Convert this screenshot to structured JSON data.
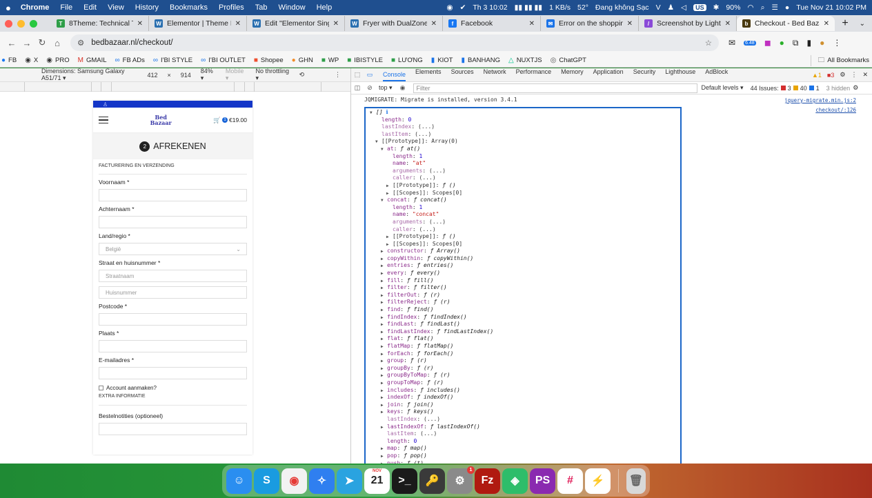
{
  "menubar": {
    "app": "Chrome",
    "menus": [
      "File",
      "Edit",
      "View",
      "History",
      "Bookmarks",
      "Profiles",
      "Tab",
      "Window",
      "Help"
    ],
    "clock_vn": "Th 3 10:02",
    "net_speed": "1 KB/s",
    "temp": "52°",
    "charge_status": "Đang không Sạc",
    "input_source": "US",
    "battery": "90%",
    "datetime": "Tue Nov 21  10:02 PM"
  },
  "tabs": [
    {
      "title": "8Theme: Technical Ticke",
      "icon": "8theme-icon",
      "color": "#2e9e48",
      "glyph": "T"
    },
    {
      "title": "Elementor | Theme Builde",
      "icon": "wordpress-icon",
      "color": "#2a6fb0",
      "glyph": "W"
    },
    {
      "title": "Edit \"Elementor Single Pr",
      "icon": "wordpress-icon",
      "color": "#2a6fb0",
      "glyph": "W"
    },
    {
      "title": "Fryer with DualZone – xs",
      "icon": "wordpress-icon",
      "color": "#2a6fb0",
      "glyph": "W"
    },
    {
      "title": "Facebook",
      "icon": "facebook-icon",
      "color": "#1877f2",
      "glyph": "f"
    },
    {
      "title": "Error on the shopping ca",
      "icon": "outlook-icon",
      "color": "#1a73e8",
      "glyph": "✉"
    },
    {
      "title": "Screenshot by Lightshot",
      "icon": "lightshot-icon",
      "color": "#8a4ad8",
      "glyph": "/"
    },
    {
      "title": "Checkout - Bed Bazaar",
      "icon": "bedbazaar-icon",
      "color": "#4a3a10",
      "glyph": "b",
      "active": true
    }
  ],
  "address": {
    "url": "bedbazaar.nl/checkout/",
    "ext_badge": "6.48"
  },
  "bookmarks": [
    {
      "label": "FB",
      "glyph": "●",
      "color": "#1877f2"
    },
    {
      "label": "X",
      "glyph": "◉",
      "color": "#333"
    },
    {
      "label": "PRO",
      "glyph": "◉",
      "color": "#333"
    },
    {
      "label": "GMAIL",
      "glyph": "M",
      "color": "#d93025"
    },
    {
      "label": "FB ADs",
      "glyph": "∞",
      "color": "#1a73e8"
    },
    {
      "label": "I'BI STYLE",
      "glyph": "∞",
      "color": "#1a73e8"
    },
    {
      "label": "I'BI OUTLET",
      "glyph": "∞",
      "color": "#1a73e8"
    },
    {
      "label": "Shopee",
      "glyph": "■",
      "color": "#ee4d2d"
    },
    {
      "label": "GHN",
      "glyph": "●",
      "color": "#f28c28"
    },
    {
      "label": "WP",
      "glyph": "■",
      "color": "#2e9e48"
    },
    {
      "label": "IBISTYLE",
      "glyph": "■",
      "color": "#2e9e48"
    },
    {
      "label": "LƯƠNG",
      "glyph": "■",
      "color": "#2e9e48"
    },
    {
      "label": "KIOT",
      "glyph": "▮",
      "color": "#1a73e8"
    },
    {
      "label": "BANHANG",
      "glyph": "▮",
      "color": "#1a73e8"
    },
    {
      "label": "NUXTJS",
      "glyph": "△",
      "color": "#00c58e"
    },
    {
      "label": "ChatGPT",
      "glyph": "◎",
      "color": "#555"
    }
  ],
  "all_bookmarks": "All Bookmarks",
  "device_toolbar": {
    "dimensions": "Dimensions: Samsung Galaxy A51/71 ▾",
    "width": "412",
    "x": "×",
    "height": "914",
    "zoom": "84% ▾",
    "mode": "Mobile ▾",
    "throttling": "No throttling ▾"
  },
  "site": {
    "cart_count": "1",
    "cart_total": "€19.00",
    "logo_line1": "Bed",
    "logo_line2": "Bazaar",
    "step": "2",
    "title": "AFREKENEN",
    "section_billing": "FACTURERING EN VERZENDING",
    "fields": {
      "first_name": "Voornaam *",
      "last_name": "Achternaam *",
      "country": "Land/regio *",
      "country_value": "België",
      "street": "Straat en huisnummer *",
      "street_placeholder": "Straatnaam",
      "house_placeholder": "Huisnummer",
      "postcode": "Postcode *",
      "city": "Plaats *",
      "email": "E-mailadres *"
    },
    "create_account": "Account aanmaken?",
    "section_extra": "EXTRA INFORMATIE",
    "order_notes": "Bestelnotities (optioneel)"
  },
  "devtools": {
    "tabs": [
      "Console",
      "Elements",
      "Sources",
      "Network",
      "Performance",
      "Memory",
      "Application",
      "Security",
      "Lighthouse",
      "AdBlock"
    ],
    "active_tab": "Console",
    "warnings": "1",
    "errors": "3",
    "context": "top ▾",
    "filter_placeholder": "Filter",
    "levels": "Default levels ▾",
    "issues_label": "44 Issues:",
    "issues_err": "3",
    "issues_warn": "40",
    "issues_info": "1",
    "hidden": "3 hidden",
    "console": {
      "migrate_msg": "JQMIGRATE: Migrate is installed, version 3.4.1",
      "migrate_src": "jquery-migrate.min.js:2",
      "log_src": "checkout/:126",
      "lines": [
        {
          "ind": 0,
          "arrow": "▼",
          "key": "[]",
          "val": "",
          "kc": "fn"
        },
        {
          "ind": 1,
          "arrow": "",
          "key": "length",
          "val": "0",
          "vc": "v"
        },
        {
          "ind": 1,
          "arrow": "",
          "key": "lastIndex",
          "val": "(...)",
          "kdim": true
        },
        {
          "ind": 1,
          "arrow": "",
          "key": "lastItem",
          "val": "(...)",
          "kdim": true
        },
        {
          "ind": 1,
          "arrow": "▼",
          "key": "[[Prototype]]",
          "val": "Array(0)",
          "kplain": true
        },
        {
          "ind": 2,
          "arrow": "▼",
          "key": "at",
          "val": "ƒ at()",
          "vc": "fn"
        },
        {
          "ind": 3,
          "arrow": "",
          "key": "length",
          "val": "1",
          "vc": "v"
        },
        {
          "ind": 3,
          "arrow": "",
          "key": "name",
          "val": "\"at\"",
          "vc": "s"
        },
        {
          "ind": 3,
          "arrow": "",
          "key": "arguments",
          "val": "(...)",
          "kdim": true
        },
        {
          "ind": 3,
          "arrow": "",
          "key": "caller",
          "val": "(...)",
          "kdim": true
        },
        {
          "ind": 3,
          "arrow": "▶",
          "key": "[[Prototype]]",
          "val": "ƒ ()",
          "vc": "fn",
          "kplain": true
        },
        {
          "ind": 3,
          "arrow": "▶",
          "key": "[[Scopes]]",
          "val": "Scopes[0]",
          "kplain": true
        },
        {
          "ind": 2,
          "arrow": "▼",
          "key": "concat",
          "val": "ƒ concat()",
          "vc": "fn"
        },
        {
          "ind": 3,
          "arrow": "",
          "key": "length",
          "val": "1",
          "vc": "v"
        },
        {
          "ind": 3,
          "arrow": "",
          "key": "name",
          "val": "\"concat\"",
          "vc": "s"
        },
        {
          "ind": 3,
          "arrow": "",
          "key": "arguments",
          "val": "(...)",
          "kdim": true
        },
        {
          "ind": 3,
          "arrow": "",
          "key": "caller",
          "val": "(...)",
          "kdim": true
        },
        {
          "ind": 3,
          "arrow": "▶",
          "key": "[[Prototype]]",
          "val": "ƒ ()",
          "vc": "fn",
          "kplain": true
        },
        {
          "ind": 3,
          "arrow": "▶",
          "key": "[[Scopes]]",
          "val": "Scopes[0]",
          "kplain": true
        },
        {
          "ind": 2,
          "arrow": "▶",
          "key": "constructor",
          "val": "ƒ Array()",
          "vc": "fn"
        },
        {
          "ind": 2,
          "arrow": "▶",
          "key": "copyWithin",
          "val": "ƒ copyWithin()",
          "vc": "fn"
        },
        {
          "ind": 2,
          "arrow": "▶",
          "key": "entries",
          "val": "ƒ entries()",
          "vc": "fn"
        },
        {
          "ind": 2,
          "arrow": "▶",
          "key": "every",
          "val": "ƒ every()",
          "vc": "fn"
        },
        {
          "ind": 2,
          "arrow": "▶",
          "key": "fill",
          "val": "ƒ fill()",
          "vc": "fn"
        },
        {
          "ind": 2,
          "arrow": "▶",
          "key": "filter",
          "val": "ƒ filter()",
          "vc": "fn"
        },
        {
          "ind": 2,
          "arrow": "▶",
          "key": "filterOut",
          "val": "ƒ (r)",
          "vc": "fn"
        },
        {
          "ind": 2,
          "arrow": "▶",
          "key": "filterReject",
          "val": "ƒ (r)",
          "vc": "fn"
        },
        {
          "ind": 2,
          "arrow": "▶",
          "key": "find",
          "val": "ƒ find()",
          "vc": "fn"
        },
        {
          "ind": 2,
          "arrow": "▶",
          "key": "findIndex",
          "val": "ƒ findIndex()",
          "vc": "fn"
        },
        {
          "ind": 2,
          "arrow": "▶",
          "key": "findLast",
          "val": "ƒ findLast()",
          "vc": "fn"
        },
        {
          "ind": 2,
          "arrow": "▶",
          "key": "findLastIndex",
          "val": "ƒ findLastIndex()",
          "vc": "fn"
        },
        {
          "ind": 2,
          "arrow": "▶",
          "key": "flat",
          "val": "ƒ flat()",
          "vc": "fn"
        },
        {
          "ind": 2,
          "arrow": "▶",
          "key": "flatMap",
          "val": "ƒ flatMap()",
          "vc": "fn"
        },
        {
          "ind": 2,
          "arrow": "▶",
          "key": "forEach",
          "val": "ƒ forEach()",
          "vc": "fn"
        },
        {
          "ind": 2,
          "arrow": "▶",
          "key": "group",
          "val": "ƒ (r)",
          "vc": "fn"
        },
        {
          "ind": 2,
          "arrow": "▶",
          "key": "groupBy",
          "val": "ƒ (r)",
          "vc": "fn"
        },
        {
          "ind": 2,
          "arrow": "▶",
          "key": "groupByToMap",
          "val": "ƒ (r)",
          "vc": "fn"
        },
        {
          "ind": 2,
          "arrow": "▶",
          "key": "groupToMap",
          "val": "ƒ (r)",
          "vc": "fn"
        },
        {
          "ind": 2,
          "arrow": "▶",
          "key": "includes",
          "val": "ƒ includes()",
          "vc": "fn"
        },
        {
          "ind": 2,
          "arrow": "▶",
          "key": "indexOf",
          "val": "ƒ indexOf()",
          "vc": "fn"
        },
        {
          "ind": 2,
          "arrow": "▶",
          "key": "join",
          "val": "ƒ join()",
          "vc": "fn"
        },
        {
          "ind": 2,
          "arrow": "▶",
          "key": "keys",
          "val": "ƒ keys()",
          "vc": "fn"
        },
        {
          "ind": 2,
          "arrow": "",
          "key": "lastIndex",
          "val": "(...)",
          "kdim": true
        },
        {
          "ind": 2,
          "arrow": "▶",
          "key": "lastIndexOf",
          "val": "ƒ lastIndexOf()",
          "vc": "fn"
        },
        {
          "ind": 2,
          "arrow": "",
          "key": "lastItem",
          "val": "(...)",
          "kdim": true
        },
        {
          "ind": 2,
          "arrow": "",
          "key": "length",
          "val": "0",
          "vc": "v"
        },
        {
          "ind": 2,
          "arrow": "▶",
          "key": "map",
          "val": "ƒ map()",
          "vc": "fn"
        },
        {
          "ind": 2,
          "arrow": "▶",
          "key": "pop",
          "val": "ƒ pop()",
          "vc": "fn"
        },
        {
          "ind": 2,
          "arrow": "▶",
          "key": "push",
          "val": "ƒ (t)",
          "vc": "fn"
        }
      ]
    }
  },
  "dock": [
    {
      "name": "finder",
      "label": "☺",
      "bg": "#2a8ef0"
    },
    {
      "name": "skype",
      "label": "S",
      "bg": "#1a9be0"
    },
    {
      "name": "chrome",
      "label": "◉",
      "bg": "#f2f2f2",
      "fg": "#e53935"
    },
    {
      "name": "safari",
      "label": "✧",
      "bg": "#2f7ff0"
    },
    {
      "name": "telegram",
      "label": "➤",
      "bg": "#2aa3e0"
    },
    {
      "name": "calendar",
      "label": "21",
      "bg": "#ffffff",
      "fg": "#222",
      "top": "NOV"
    },
    {
      "name": "terminal",
      "label": ">_",
      "bg": "#1a1a1a"
    },
    {
      "name": "keychain",
      "label": "🔑",
      "bg": "#3a3a3a"
    },
    {
      "name": "system-settings",
      "label": "⚙",
      "bg": "#8a8a8a",
      "badge": "1"
    },
    {
      "name": "filezilla",
      "label": "Fz",
      "bg": "#b01a10"
    },
    {
      "name": "sourcetree",
      "label": "◈",
      "bg": "#2ebd6a"
    },
    {
      "name": "phpstorm",
      "label": "PS",
      "bg": "#8a2ab0"
    },
    {
      "name": "slack",
      "label": "#",
      "bg": "#ffffff",
      "fg": "#e01e5a"
    },
    {
      "name": "messenger",
      "label": "⚡",
      "bg": "#ffffff",
      "fg": "#a33af0"
    }
  ],
  "trash": {
    "name": "trash",
    "label": "🗑"
  }
}
